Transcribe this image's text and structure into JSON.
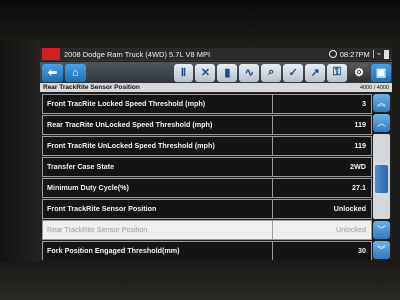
{
  "header": {
    "vehicle": "2008 Dodge Ram Truck (4WD) 5.7L V8 MPI",
    "clock": "08:27PM"
  },
  "pathbar": {
    "title": "Rear TrackRite Sensor Position",
    "count": "4000 / 4000"
  },
  "rows": [
    {
      "label": "Front TracRite Locked Speed Threshold (mph)",
      "value": "3",
      "selected": false
    },
    {
      "label": "Rear TracRite UnLocked Speed Threshold (mph)",
      "value": "119",
      "selected": false
    },
    {
      "label": "Front TracRite UnLocked Speed Threshold (mph)",
      "value": "119",
      "selected": false
    },
    {
      "label": "Transfer Case State",
      "value": "2WD",
      "selected": false
    },
    {
      "label": "Minimum Duty Cycle(%)",
      "value": "27.1",
      "selected": false
    },
    {
      "label": "Front TrackRite Sensor Position",
      "value": "Unlocked",
      "selected": false
    },
    {
      "label": "Rear TrackRite Sensor Position",
      "value": "Unlocked",
      "selected": true
    },
    {
      "label": "Fork Position Engaged Threshold(mm)",
      "value": "30",
      "selected": false
    }
  ],
  "toolbar_icons": [
    "back-icon",
    "home-icon",
    "pause-icon",
    "close-icon",
    "bar-graph-icon",
    "line-graph-icon",
    "search-icon",
    "check-icon",
    "trend-icon",
    "lock-icon",
    "gear-icon",
    "save-icon"
  ],
  "scroll_position": 0.55,
  "colors": {
    "accent": "#2f79bd",
    "row_bg": "#141414",
    "selected_bg": "#efefef",
    "badge_red": "#d21f26"
  }
}
